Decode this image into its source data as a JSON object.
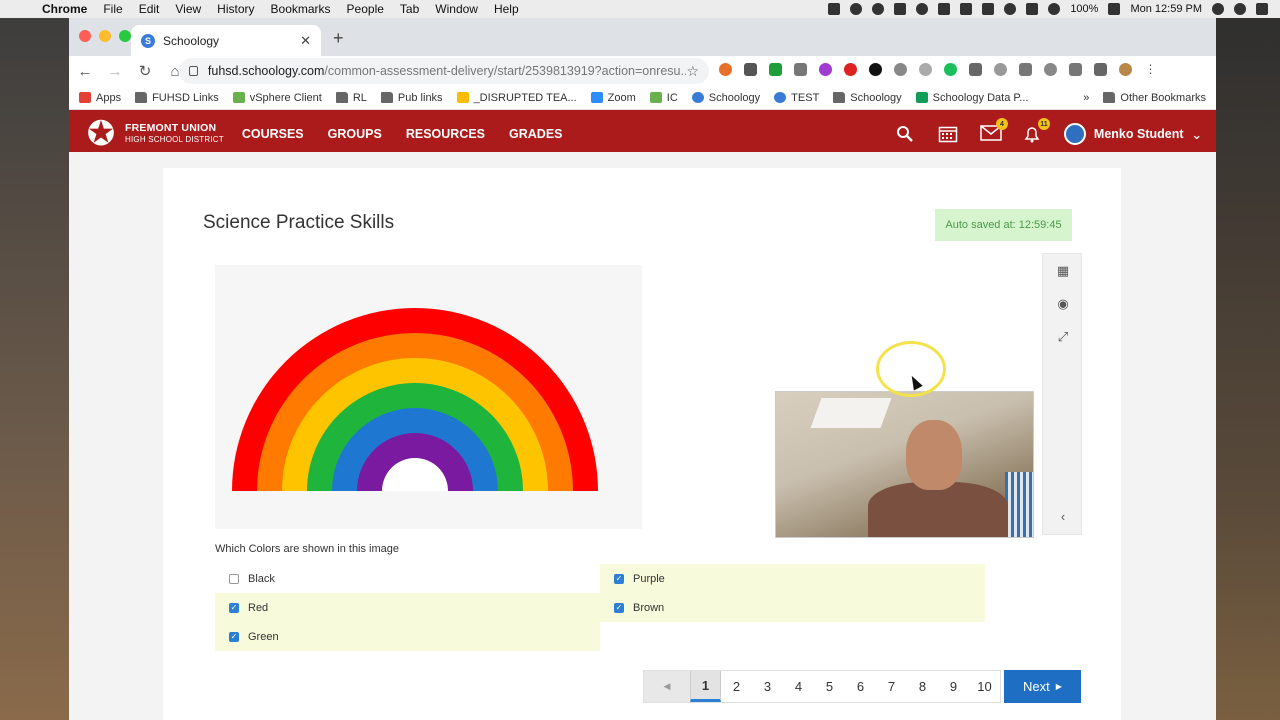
{
  "menubar": {
    "app": "Chrome",
    "items": [
      "File",
      "Edit",
      "View",
      "History",
      "Bookmarks",
      "People",
      "Tab",
      "Window",
      "Help"
    ],
    "battery": "100%",
    "clock": "Mon 12:59 PM"
  },
  "browser": {
    "tab_title": "Schoology",
    "url_host": "fuhsd.schoology.com",
    "url_path": "/common-assessment-delivery/start/2539813919?action=onresu...",
    "bookmarks": [
      "Apps",
      "FUHSD Links",
      "vSphere Client",
      "RL",
      "Pub links",
      "_DISRUPTED TEA...",
      "Zoom",
      "IC",
      "Schoology",
      "TEST",
      "Schoology",
      "Schoology Data P..."
    ],
    "other_bookmarks": "Other Bookmarks"
  },
  "header": {
    "logo_line1": "FREMONT UNION",
    "logo_line2": "HIGH SCHOOL DISTRICT",
    "nav": [
      "COURSES",
      "GROUPS",
      "RESOURCES",
      "GRADES"
    ],
    "mail_badge": "4",
    "notif_badge": "11",
    "user_name": "Menko Student"
  },
  "assessment": {
    "title": "Science Practice Skills",
    "autosave": "Auto saved at: 12:59:45",
    "prompt": "Which Colors are shown in this image",
    "options": [
      {
        "label": "Black",
        "checked": false
      },
      {
        "label": "Red",
        "checked": true
      },
      {
        "label": "Green",
        "checked": true
      },
      {
        "label": "Purple",
        "checked": true
      },
      {
        "label": "Brown",
        "checked": true
      }
    ],
    "rainbow_colors": [
      "#ff0000",
      "#ff7a00",
      "#ffc400",
      "#1fb43c",
      "#1e78d2",
      "#7a1aa0"
    ]
  },
  "pager": {
    "pages": [
      "1",
      "2",
      "3",
      "4",
      "5",
      "6",
      "7",
      "8",
      "9",
      "10"
    ],
    "current": "1",
    "next_label": "Next"
  }
}
